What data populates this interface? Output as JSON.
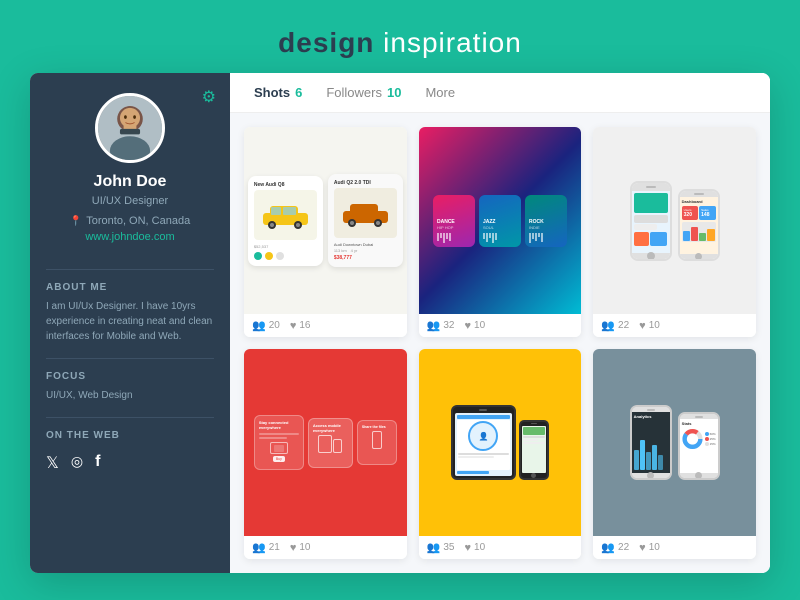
{
  "site": {
    "title_bold": "design",
    "title_light": " inspiration"
  },
  "sidebar": {
    "user": {
      "name": "John Doe",
      "role": "UI/UX Designer",
      "location": "Toronto, ON, Canada",
      "website": "www.johndoe.com"
    },
    "about": {
      "title": "ABOUT ME",
      "text": "I am UI/Ux Designer. I have 10yrs experience in creating neat and clean interfaces for Mobile and Web."
    },
    "focus": {
      "title": "FOCUS",
      "text": "UI/UX, Web Design"
    },
    "on_the_web": {
      "title": "ON THE WEB"
    }
  },
  "nav": {
    "shots_label": "Shots",
    "shots_count": "6",
    "followers_label": "Followers",
    "followers_count": "10",
    "more_label": "More"
  },
  "shots": [
    {
      "views": "20",
      "likes": "16"
    },
    {
      "views": "32",
      "likes": "10"
    },
    {
      "views": "22",
      "likes": "10"
    },
    {
      "views": "21",
      "likes": "10"
    },
    {
      "views": "35",
      "likes": "10"
    },
    {
      "views": "22",
      "likes": "10"
    }
  ],
  "colors": {
    "teal": "#1abc9c",
    "dark": "#2c3e50",
    "red": "#e53935",
    "yellow": "#ffc107",
    "gray": "#78909c"
  }
}
